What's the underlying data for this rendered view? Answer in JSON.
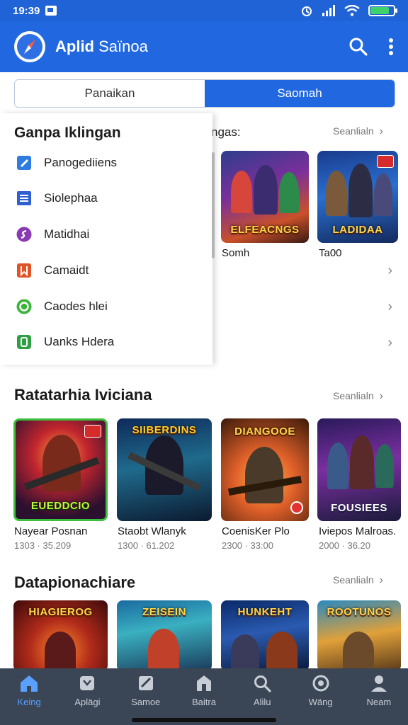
{
  "status_bar": {
    "time": "19:39"
  },
  "app_bar": {
    "title_main": "Aplid",
    "title_sub": "Saïnoa",
    "logo_icon": "compass-icon",
    "search_icon": "search-icon",
    "menu_icon": "more-vert-icon"
  },
  "tabs": [
    {
      "label": "Panaikan",
      "active": false
    },
    {
      "label": "Saomah",
      "active": true
    }
  ],
  "background_section": {
    "header_fragment": "ngas:",
    "see_all": "Seanlialn",
    "games": [
      {
        "name": "Somh",
        "logo_text": "ELFEACNGS"
      },
      {
        "name": "Ta00",
        "logo_text": "LADIDAA"
      }
    ]
  },
  "drawer": {
    "title": "Ganpa Iklingan",
    "items": [
      {
        "label": "Panogediiens",
        "icon": "edit-icon",
        "color": "#2f7ce0"
      },
      {
        "label": "Siolephaa",
        "icon": "list-icon",
        "color": "#2f5fd0"
      },
      {
        "label": "Matidhai",
        "icon": "swap-icon",
        "color": "#8a3ab2"
      },
      {
        "label": "Camaidt",
        "icon": "bookmark-icon",
        "color": "#e05326"
      },
      {
        "label": "Caodes hlei",
        "icon": "circle-icon",
        "color": "#3cb43c"
      },
      {
        "label": "Uanks Hdera",
        "icon": "phone-icon",
        "color": "#2ea043"
      }
    ]
  },
  "section_popular": {
    "title": "Ratatarhia Iviciana",
    "see_all": "Seanlialn",
    "games": [
      {
        "name": "Nayear Posnan",
        "meta": "1303 · 35.209",
        "logo_text": "EUEDDCIO"
      },
      {
        "name": "Staobt Wlanyk",
        "meta": "1300 · 61.202",
        "logo_text": "SIIBERDINS"
      },
      {
        "name": "CoenisKer Plo",
        "meta": "2300 · 33:00",
        "logo_text": "DIANGOOE"
      },
      {
        "name": "Iviepos Malroas.",
        "meta": "2000 · 36.20",
        "logo_text": "FOUSIEES"
      }
    ]
  },
  "section_more": {
    "title": "Datapionachiare",
    "see_all": "Seanlialn",
    "games": [
      {
        "logo_text": "HIAGIEROG"
      },
      {
        "logo_text": "ZEISEIN"
      },
      {
        "logo_text": "HUNKEHT"
      },
      {
        "logo_text": "ROOTUNOS"
      }
    ]
  },
  "bottom_nav": [
    {
      "label": "Keing",
      "icon": "home-icon",
      "active": true
    },
    {
      "label": "Aplägi",
      "icon": "apps-icon",
      "active": false
    },
    {
      "label": "Samoe",
      "icon": "games-icon",
      "active": false
    },
    {
      "label": "Baitra",
      "icon": "store-icon",
      "active": false
    },
    {
      "label": "Alilu",
      "icon": "search-icon",
      "active": false
    },
    {
      "label": "Wäng",
      "icon": "discover-icon",
      "active": false
    },
    {
      "label": "Neam",
      "icon": "profile-icon",
      "active": false
    }
  ],
  "colors": {
    "primary": "#2168e0",
    "nav_bg": "#3a4555",
    "nav_active": "#5aa0ff"
  }
}
